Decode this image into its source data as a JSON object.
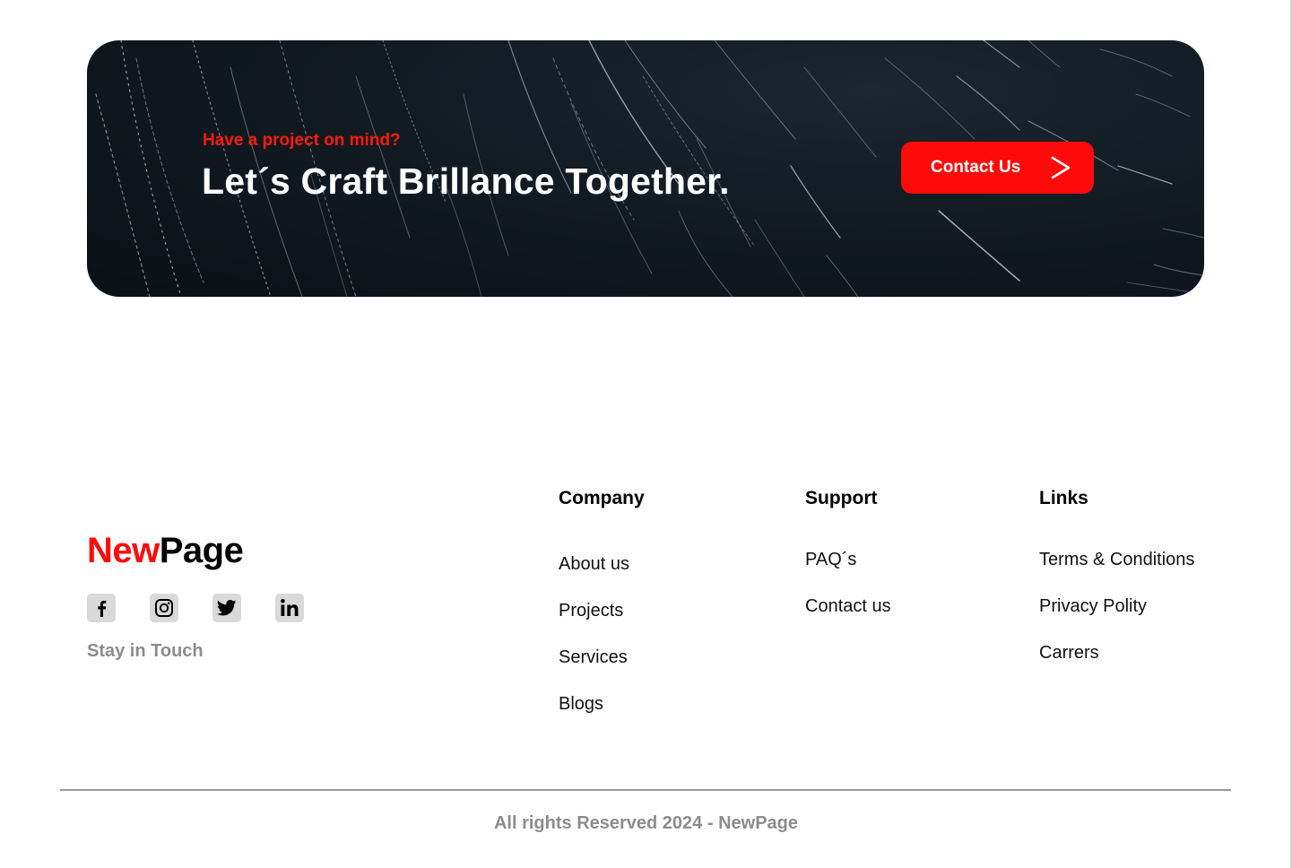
{
  "cta": {
    "kicker": "Have a project on mind?",
    "title": "Let´s Craft Brillance Together.",
    "button_label": "Contact Us",
    "button_icon": "chevron-right-icon"
  },
  "brand": {
    "part1": "New",
    "part2": "Page",
    "accent_color": "#ff0a0a"
  },
  "social": {
    "icons": [
      "facebook-icon",
      "instagram-icon",
      "twitter-icon",
      "linkedin-icon"
    ],
    "caption": "Stay in Touch"
  },
  "columns": {
    "company": {
      "heading": "Company",
      "links": [
        "About us",
        "Projects",
        "Services",
        "Blogs"
      ]
    },
    "support": {
      "heading": "Support",
      "links": [
        "PAQ´s",
        "Contact us"
      ]
    },
    "links": {
      "heading": "Links",
      "links": [
        "Terms & Conditions",
        "Privacy Polity",
        "Carrers"
      ]
    }
  },
  "footer": {
    "copyright": "All rights Reserved 2024 - NewPage"
  }
}
